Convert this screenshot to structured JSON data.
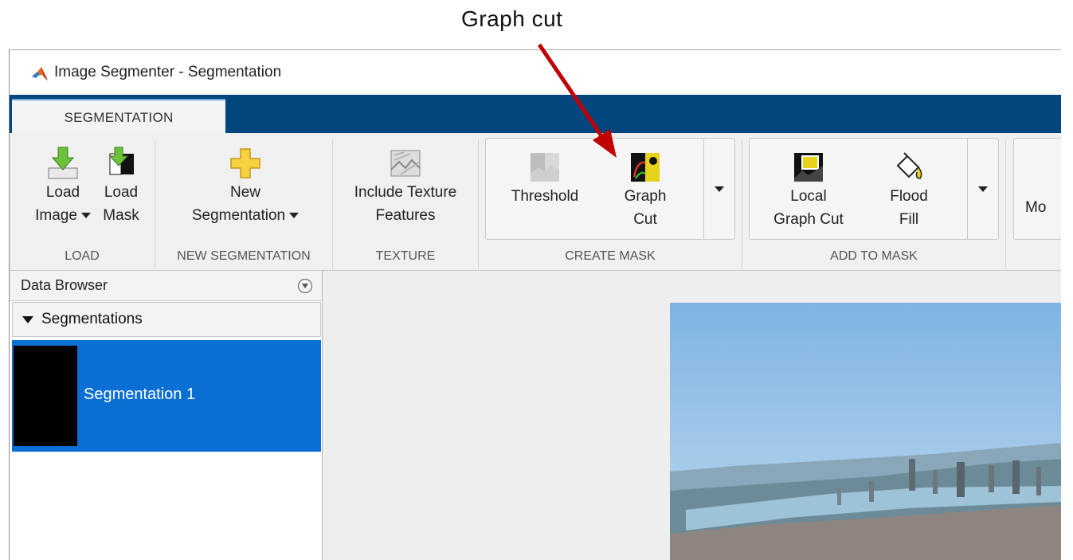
{
  "callout": {
    "text": "Graph cut"
  },
  "window": {
    "title": "Image Segmenter - Segmentation",
    "app_icon": "matlab-logo-icon"
  },
  "tabs": [
    {
      "label": "SEGMENTATION",
      "active": true
    }
  ],
  "toolstrip": {
    "load": {
      "group_label": "LOAD",
      "load_image": {
        "line1": "Load",
        "line2": "Image",
        "icon": "load-image-icon",
        "has_dropdown": true
      },
      "load_mask": {
        "line1": "Load",
        "line2": "Mask",
        "icon": "load-mask-icon"
      }
    },
    "new_segmentation": {
      "group_label": "NEW SEGMENTATION",
      "button": {
        "line1": "New",
        "line2": "Segmentation",
        "icon": "plus-icon",
        "has_dropdown": true
      }
    },
    "texture": {
      "group_label": "TEXTURE",
      "button": {
        "line1": "Include Texture",
        "line2": "Features",
        "icon": "texture-icon"
      }
    },
    "create_mask": {
      "group_label": "CREATE MASK",
      "threshold": {
        "line1": "Threshold",
        "icon": "threshold-icon"
      },
      "graph_cut": {
        "line1": "Graph",
        "line2": "Cut",
        "icon": "graph-cut-icon"
      }
    },
    "add_to_mask": {
      "group_label": "ADD TO MASK",
      "local_graph_cut": {
        "line1": "Local",
        "line2": "Graph Cut",
        "icon": "local-graph-cut-icon"
      },
      "flood_fill": {
        "line1": "Flood",
        "line2": "Fill",
        "icon": "flood-fill-icon"
      }
    },
    "cut_off_label": "Mo"
  },
  "data_browser": {
    "title": "Data Browser",
    "section_label": "Segmentations",
    "items": [
      {
        "name": "Segmentation 1",
        "selected": true
      }
    ]
  },
  "colors": {
    "tab_strip": "#00457b",
    "selection": "#0a6fd4",
    "callout_arrow": "#c00000"
  }
}
